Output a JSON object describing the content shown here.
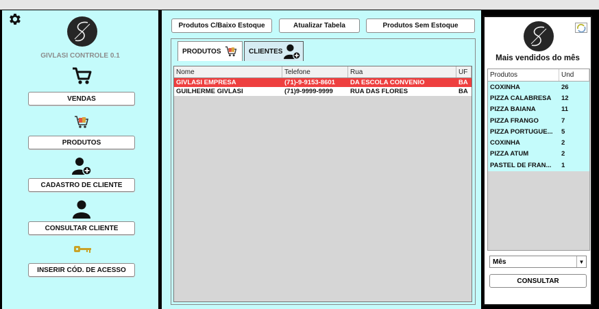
{
  "app": {
    "title": "GIVLASI CONTROLE 0.1"
  },
  "sidebar": {
    "items": [
      {
        "label": "VENDAS",
        "icon": "cart-icon"
      },
      {
        "label": "PRODUTOS",
        "icon": "shopping-cart-products-icon"
      },
      {
        "label": "CADASTRO DE CLIENTE",
        "icon": "add-user-icon"
      },
      {
        "label": "CONSULTAR CLIENTE",
        "icon": "user-icon"
      },
      {
        "label": "INSERIR CÓD. DE ACESSO",
        "icon": "key-icon"
      }
    ]
  },
  "toolbar": {
    "low_stock": "Produtos C/Baixo Estoque",
    "refresh": "Atualizar Tabela",
    "no_stock": "Produtos Sem Estoque"
  },
  "tabs": [
    {
      "label": "PRODUTOS",
      "icon": "products-icon"
    },
    {
      "label": "CLIENTES",
      "icon": "clients-icon",
      "active": true
    }
  ],
  "clients_table": {
    "columns": [
      "Nome",
      "Telefone",
      "Rua",
      "UF"
    ],
    "rows": [
      {
        "nome": "GIVLASI EMPRESA",
        "telefone": "(71)-9-9153-8601",
        "rua": "DA ESCOLA CONVENIO",
        "uf": "BA",
        "selected": true
      },
      {
        "nome": "GUILHERME GIVLASI",
        "telefone": "(71)9-9999-9999",
        "rua": "RUA DAS FLORES",
        "uf": "BA",
        "selected": false
      }
    ]
  },
  "best_sellers": {
    "title": "Mais vendidos do mês",
    "columns": [
      "Produtos",
      "Und"
    ],
    "rows": [
      {
        "produto": "COXINHA",
        "und": "26"
      },
      {
        "produto": "PIZZA CALABRESA",
        "und": "12"
      },
      {
        "produto": "PIZZA BAIANA",
        "und": "11"
      },
      {
        "produto": "PIZZA FRANGO",
        "und": "7"
      },
      {
        "produto": "PIZZA PORTUGUE...",
        "und": "5"
      },
      {
        "produto": "COXINHA",
        "und": "2"
      },
      {
        "produto": "PIZZA ATUM",
        "und": "2"
      },
      {
        "produto": "PASTEL DE FRAN...",
        "und": "1"
      }
    ],
    "period_selected": "Mês",
    "consult_label": "CONSULTAR"
  },
  "colors": {
    "panel": "#c4fbfb",
    "selected_row": "#ee3f3f"
  }
}
